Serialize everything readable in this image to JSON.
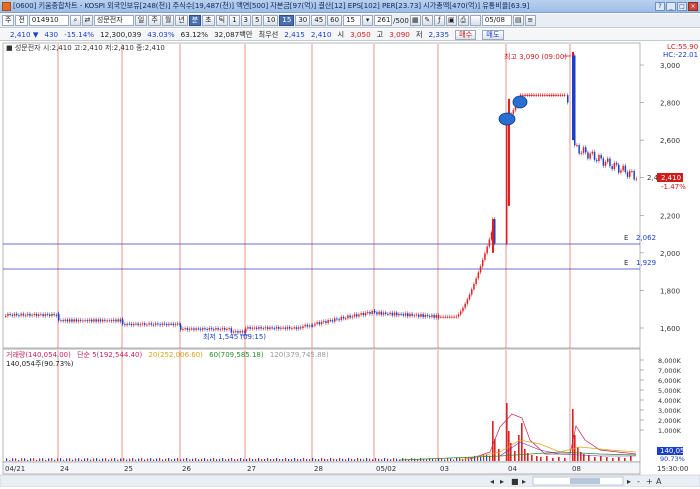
{
  "title_bar": {
    "text": "[0600] 키움종합차트 - KOSPI 외국인보유[248(천)] 주식수[19,487(천)] 액면[500] 자본금[97(억)] 결산[12] EPS[102] PER[23.73] 시가총액[470(억)] 유통비율[63.9]",
    "buttons": [
      "?",
      "_",
      "□",
      "×"
    ]
  },
  "toolbar": {
    "market": "주",
    "type": "전",
    "code": "014910",
    "stock_name": "성문전자",
    "periods": [
      "일",
      "주",
      "월",
      "년",
      "분",
      "초",
      "틱"
    ],
    "selected_period": "분",
    "intervals": [
      "1",
      "3",
      "5",
      "10",
      "15",
      "30",
      "45",
      "60"
    ],
    "selected_interval": "15",
    "interval_value": "15",
    "count": "261",
    "count_total": "/500",
    "date": "05/08"
  },
  "quote": {
    "price": "2,410",
    "change": "430",
    "change_pct": "-15.14%",
    "volume": "12,300,039",
    "ratio1": "43.03%",
    "ratio2": "63.12%",
    "amount": "32,087백만",
    "limit_label": "최우선",
    "best_ask": "2,415",
    "best_bid": "2,410",
    "open_label": "시",
    "open": "3,050",
    "high_label": "고",
    "high": "3,090",
    "low_label": "저",
    "low": "2,335",
    "buy_btn": "매수",
    "sell_btn": "매도"
  },
  "price_panel": {
    "legend": "■ 성문전자 시:2,410 고:2,410 저:2,410 종:2,410",
    "lc_label": "LC:55.90",
    "hc_label": "HC:-22.01",
    "high_annotation": "최고 3,090 (09:00)",
    "low_annotation": "최저 1,545 (09:15)",
    "current_price": "2,410",
    "current_pct": "-1.47%",
    "current_tick_label": "2,4",
    "hline1_label": "2,062",
    "hline2_label": "1,929",
    "y_ticks": [
      "3,000",
      "2,800",
      "2,600",
      "2,400",
      "2,200",
      "2,000",
      "1,800",
      "1,600"
    ]
  },
  "volume_panel": {
    "legend_items": [
      {
        "text": "거래량(140,054.00)",
        "color": "#c0245e"
      },
      {
        "text": "단순 5(192,544.40)",
        "color": "#c0245e"
      },
      {
        "text": "20(252,006.60)",
        "color": "#d9a21a"
      },
      {
        "text": "60(709,585.18)",
        "color": "#2a8c2a"
      },
      {
        "text": "120(379,745.88)",
        "color": "#999999"
      }
    ],
    "sub_legend": "140,054주(90.73%)",
    "current_volume": "140,054",
    "current_pct": "90.73%",
    "y_ticks": [
      "8,000K",
      "7,000K",
      "6,000K",
      "5,000K",
      "4,000K",
      "3,000K",
      "2,000K",
      "1,000K"
    ]
  },
  "x_axis": {
    "labels": [
      "04/21",
      "24",
      "25",
      "26",
      "27",
      "28",
      "05/02",
      "03",
      "04",
      "08"
    ],
    "end_time": "15:30:00"
  },
  "colors": {
    "up": "#e02020",
    "down": "#1a3fc9",
    "day_line": "#d84a4a",
    "hline": "#4040c0"
  }
}
